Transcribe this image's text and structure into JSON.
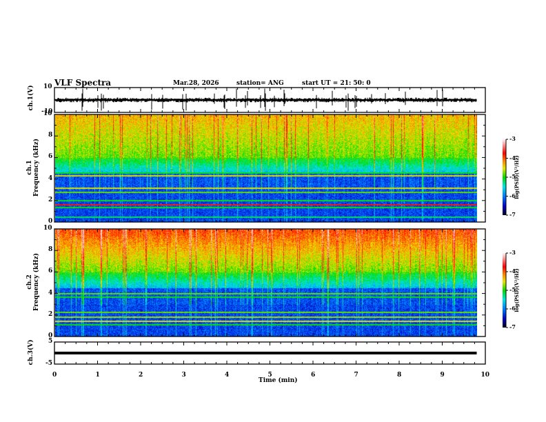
{
  "header": {
    "title": "VLF Spectra",
    "date": "Mar.28, 2026",
    "station": "station= ANG",
    "start": "start  UT =   21: 50: 0"
  },
  "chart_data": [
    {
      "type": "line",
      "panel": "ch1-waveform",
      "ylabel": "ch.1(V)",
      "ylim": [
        -10,
        10
      ],
      "yticks": [
        "10",
        "-10"
      ],
      "x_range_min": [
        0,
        9.8
      ],
      "description_values": {
        "baseline": 0,
        "noise_amplitude_approx": 1.5,
        "spike_amplitude_max_approx": 5
      }
    },
    {
      "type": "heatmap",
      "panel": "ch1-spectrogram",
      "ylabel": "ch.1\nFrequency (kHz)",
      "ylim": [
        0,
        10
      ],
      "yticks": [
        "0",
        "2",
        "4",
        "6",
        "8",
        "10"
      ],
      "colorbar": {
        "label": "log(PSD)(V²/Hz)",
        "range": [
          -7,
          -3
        ],
        "ticks": [
          "-3",
          "-4",
          "-5",
          "-6",
          "-7"
        ]
      }
    },
    {
      "type": "heatmap",
      "panel": "ch2-spectrogram",
      "ylabel": "ch.2\nFrequency (kHz)",
      "ylim": [
        0,
        10
      ],
      "yticks": [
        "0",
        "2",
        "4",
        "6",
        "8",
        "10"
      ],
      "colorbar": {
        "label": "log(PSD)(V²/Hz)",
        "range": [
          -7,
          -3
        ],
        "ticks": [
          "-3",
          "-4",
          "-5",
          "-6",
          "-7"
        ]
      }
    },
    {
      "type": "line",
      "panel": "ch3-waveform",
      "ylabel": "ch.3(V)",
      "ylim": [
        -5,
        5
      ],
      "yticks": [
        "5",
        "-5"
      ],
      "constant_value_approx": 0
    }
  ],
  "xaxis": {
    "label": "Time  (min)",
    "xlim": [
      0,
      10
    ],
    "ticks": [
      "0",
      "1",
      "2",
      "3",
      "4",
      "5",
      "6",
      "7",
      "8",
      "9",
      "10"
    ]
  }
}
